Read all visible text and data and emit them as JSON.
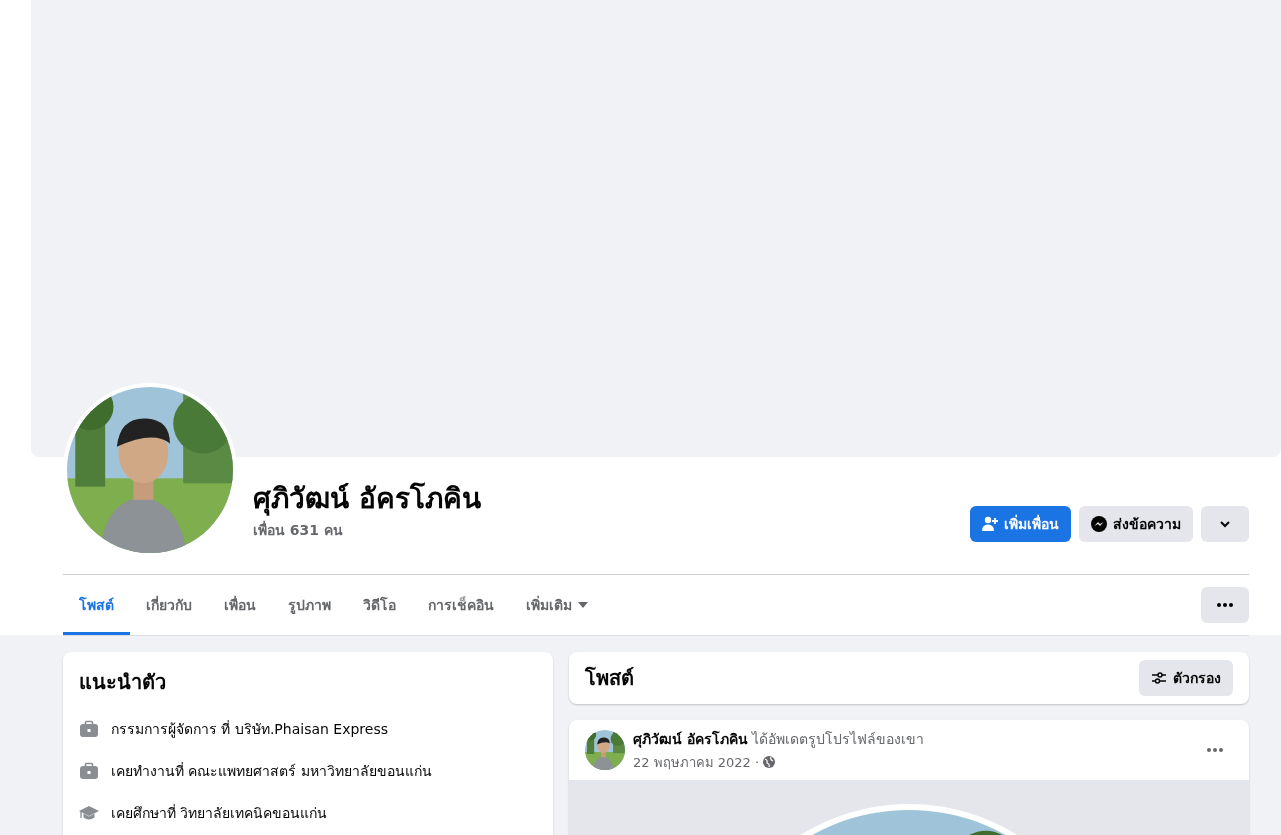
{
  "profile": {
    "name": "ศุภิวัฒน์ อัครโภคิน",
    "friends": "เพื่อน 631 คน"
  },
  "actions": [
    {
      "kind": "add-friend",
      "label": "เพิ่มเพื่อน"
    },
    {
      "kind": "message",
      "label": "ส่งข้อความ"
    },
    {
      "kind": "dropdown"
    }
  ],
  "tabs": [
    {
      "label": "โพสต์",
      "selected": true,
      "has_menu": false
    },
    {
      "label": "เกี่ยวกับ",
      "selected": false,
      "has_menu": false
    },
    {
      "label": "เพื่อน",
      "selected": false,
      "has_menu": false
    },
    {
      "label": "รูปภาพ",
      "selected": false,
      "has_menu": false
    },
    {
      "label": "วิดีโอ",
      "selected": false,
      "has_menu": false
    },
    {
      "label": "การเช็คอิน",
      "selected": false,
      "has_menu": false
    },
    {
      "label": "เพิ่มเติม",
      "selected": false,
      "has_menu": true
    }
  ],
  "intro": {
    "title": "แนะนำตัว",
    "items": [
      {
        "kind": "work",
        "text": "กรรมการผู้จัดการ ที่ บริษัท.Phaisan Express"
      },
      {
        "kind": "work",
        "text": "เคยทำงานที่ คณะแพทยศาสตร์ มหาวิทยาลัยขอนแก่น"
      },
      {
        "kind": "education",
        "text": "เคยศึกษาที่ วิทยาลัยเทคนิคขอนแก่น"
      }
    ]
  },
  "posts_header": {
    "title": "โพสต์",
    "filter_button": "ตัวกรอง"
  },
  "post": {
    "author": "ศุภิวัฒน์ อัครโภคิน",
    "action": "ได้อัพเดตรูปโปรไฟล์ของเขา",
    "date": "22 พฤษภาคม 2022 ·"
  }
}
